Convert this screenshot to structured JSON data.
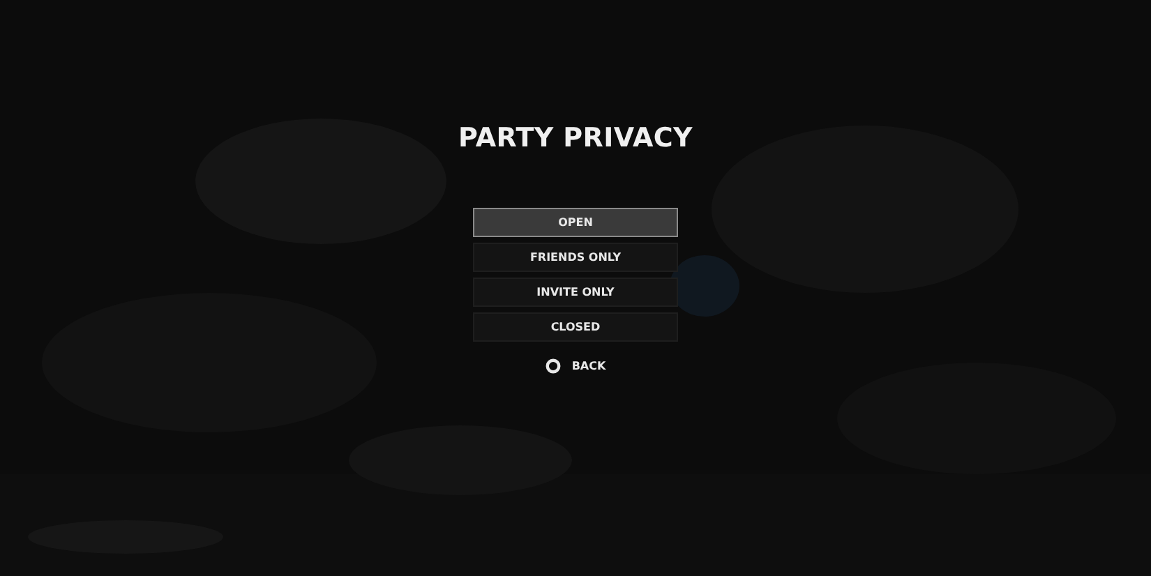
{
  "title": "PARTY PRIVACY",
  "options": [
    {
      "label": "OPEN",
      "selected": true
    },
    {
      "label": "FRIENDS ONLY",
      "selected": false
    },
    {
      "label": "INVITE ONLY",
      "selected": false
    },
    {
      "label": "CLOSED",
      "selected": false
    }
  ],
  "back": {
    "label": "BACK"
  }
}
